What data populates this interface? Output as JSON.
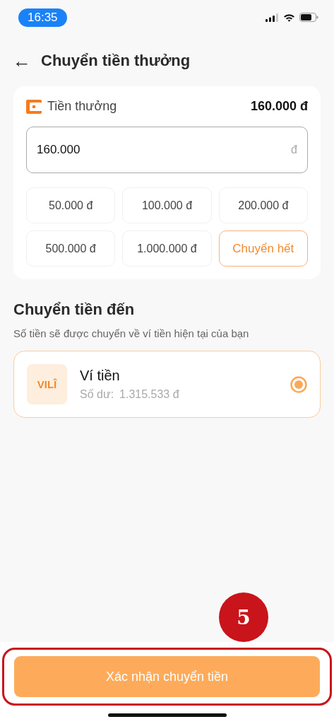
{
  "status_bar": {
    "time": "16:35"
  },
  "header": {
    "back_icon": "←",
    "title": "Chuyển tiền thưởng"
  },
  "bonus_card": {
    "label": "Tiền thưởng",
    "balance": "160.000 đ",
    "amount_field": {
      "value": "160.000",
      "unit": "đ"
    },
    "quick_amounts": [
      {
        "label": "50.000 đ",
        "kind": "amount"
      },
      {
        "label": "100.000 đ",
        "kind": "amount"
      },
      {
        "label": "200.000 đ",
        "kind": "amount"
      },
      {
        "label": "500.000 đ",
        "kind": "amount"
      },
      {
        "label": "1.000.000 đ",
        "kind": "amount"
      },
      {
        "label": "Chuyển hết",
        "kind": "all"
      }
    ]
  },
  "destination": {
    "title": "Chuyển tiền đến",
    "subtitle": "Số tiền sẽ được chuyển về ví tiền hiện tại của bạn",
    "options": [
      {
        "logo_text": "VILÎ",
        "name": "Ví tiền",
        "balance_label": "Số dư:",
        "balance": "1.315.533 đ",
        "selected": true
      }
    ]
  },
  "annotation": {
    "step": "5"
  },
  "confirm_button": {
    "label": "Xác nhận chuyển tiền"
  }
}
